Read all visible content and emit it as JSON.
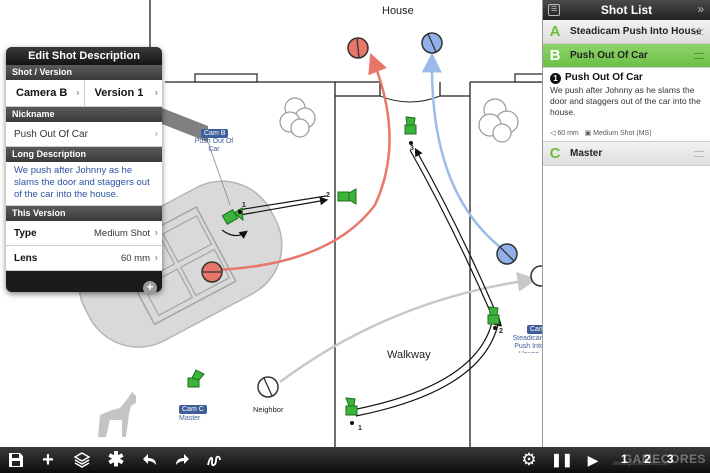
{
  "map": {
    "house_label": "House",
    "walkway_label": "Walkway",
    "neighbor_label": "Neighbor",
    "cameras": [
      {
        "tag": "Cam B",
        "sub": "Push Out Of Car"
      },
      {
        "tag": "Cam C",
        "sub": "Master"
      },
      {
        "tag": "Cam",
        "sub": "Steadicam Push Into House"
      }
    ],
    "marker_numbers": [
      "1",
      "2",
      "3",
      "1",
      "2"
    ]
  },
  "edit_panel": {
    "title": "Edit Shot Description",
    "section_version": "Shot / Version",
    "camera_value": "Camera B",
    "version_value": "Version 1",
    "section_nickname": "Nickname",
    "nickname_value": "Push Out Of Car",
    "section_long": "Long Description",
    "long_description": "We push after Johnny as he slams the door and staggers out of the car into the house.",
    "section_this_version": "This Version",
    "type_label": "Type",
    "type_value": "Medium Shot",
    "lens_label": "Lens",
    "lens_value": "60 mm"
  },
  "shot_list": {
    "title": "Shot List",
    "items": [
      {
        "letter": "A",
        "name": "Steadicam Push Into House",
        "active": false
      },
      {
        "letter": "B",
        "name": "Push Out Of Car",
        "active": true
      },
      {
        "letter": "C",
        "name": "Master",
        "active": false
      }
    ],
    "detail": {
      "number": "1",
      "title": "Push Out Of Car",
      "description": "We push after Johnny as he slams the door and staggers out of the car into the house.",
      "lens": "60 mm",
      "shot_type": "Medium Shot (MS)"
    }
  },
  "toolbar": {
    "page_numbers": [
      "1",
      "2",
      "3"
    ],
    "watermark": "GAMECORES",
    "watermark_url": "www.gamecores.com"
  },
  "colors": {
    "accent_green": "#6cbf46",
    "actor_red": "#e8776a",
    "actor_blue": "#8fb0e8",
    "camera_green": "#3cb43c",
    "path_red": "#e8776a",
    "path_blue": "#9bbbe8",
    "path_gray": "#c8c8c8"
  }
}
